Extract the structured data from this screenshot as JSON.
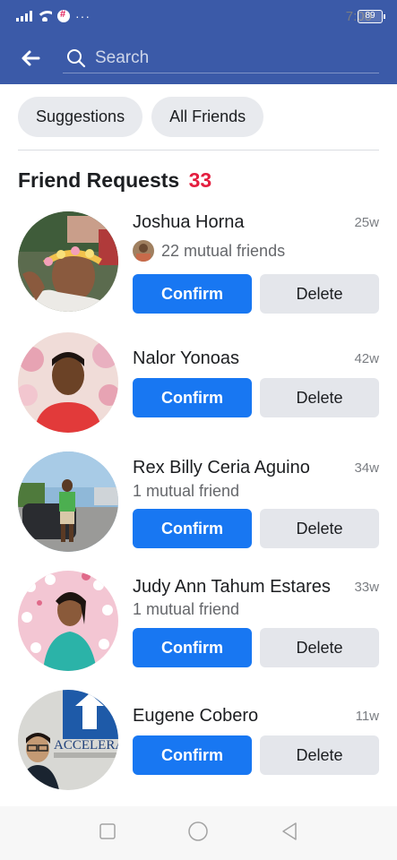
{
  "status_bar": {
    "time": "7:00",
    "dots": "···",
    "battery": "89"
  },
  "header": {
    "search_placeholder": "Search"
  },
  "chips": {
    "suggestions": "Suggestions",
    "all_friends": "All Friends"
  },
  "section": {
    "title": "Friend Requests",
    "count": "33"
  },
  "requests": [
    {
      "name": "Joshua Horna",
      "time": "25w",
      "mutual": "22 mutual friends",
      "confirm": "Confirm",
      "delete": "Delete"
    },
    {
      "name": "Nalor Yonoas",
      "time": "42w",
      "mutual": "",
      "confirm": "Confirm",
      "delete": "Delete"
    },
    {
      "name": "Rex Billy Ceria Aguino",
      "time": "34w",
      "mutual": "1 mutual friend",
      "confirm": "Confirm",
      "delete": "Delete"
    },
    {
      "name": "Judy Ann Tahum Estares",
      "time": "33w",
      "mutual": "1 mutual friend",
      "confirm": "Confirm",
      "delete": "Delete"
    },
    {
      "name": "Eugene Cobero",
      "time": "11w",
      "mutual": "",
      "confirm": "Confirm",
      "delete": "Delete"
    }
  ],
  "avatar_text": {
    "sign": "ACCELERAT"
  },
  "colors": {
    "header": "#3b5aa8",
    "confirm": "#1877f2",
    "count": "#e41e3f",
    "delete_bg": "#e4e6eb"
  },
  "icons": {
    "back": "back-arrow-icon",
    "search": "search-icon",
    "nav_square": "recent-apps-icon",
    "nav_circle": "home-icon",
    "nav_triangle": "back-nav-icon"
  }
}
